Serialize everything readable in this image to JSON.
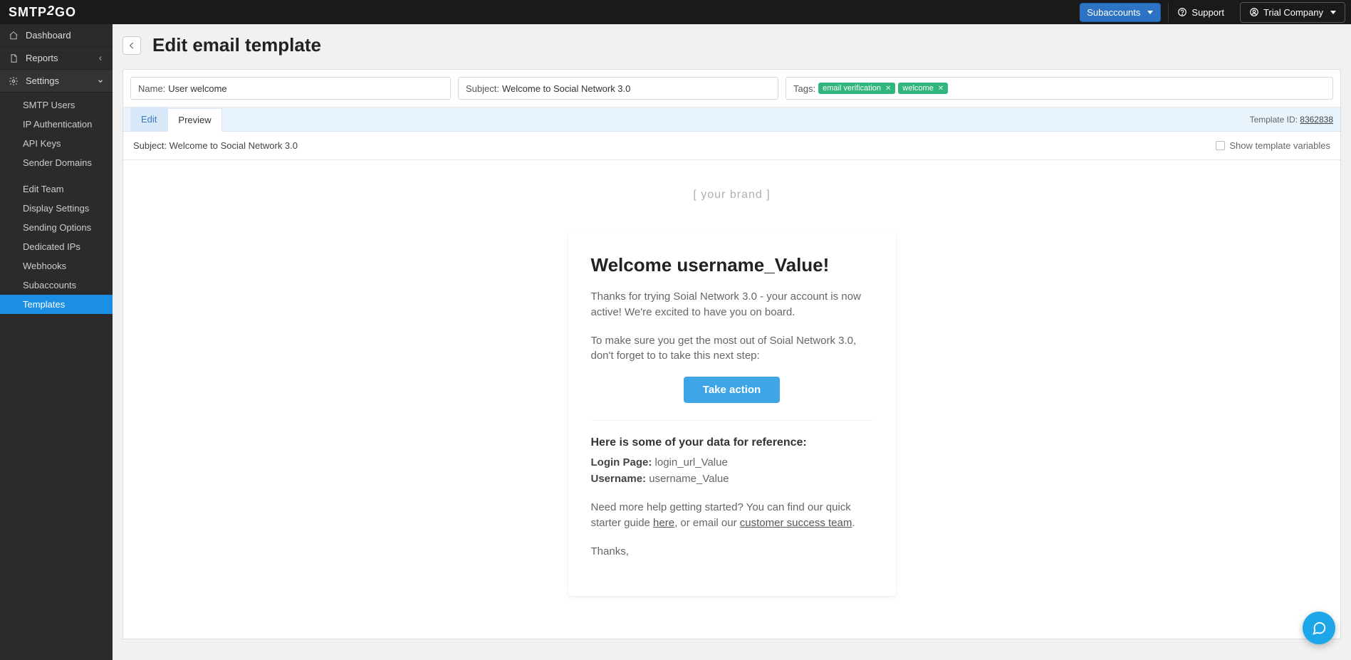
{
  "topbar": {
    "logo_pre": "SMTP",
    "logo_mid": "2",
    "logo_post": "GO",
    "subaccounts": "Subaccounts",
    "support": "Support",
    "company": "Trial Company"
  },
  "sidebar": {
    "dashboard": "Dashboard",
    "reports": "Reports",
    "settings": "Settings",
    "items_a": {
      "smtp_users": "SMTP Users",
      "ip_auth": "IP Authentication",
      "api_keys": "API Keys",
      "sender_domains": "Sender Domains"
    },
    "items_b": {
      "edit_team": "Edit Team",
      "display_settings": "Display Settings",
      "sending_options": "Sending Options",
      "dedicated_ips": "Dedicated IPs",
      "webhooks": "Webhooks",
      "subaccounts": "Subaccounts",
      "templates": "Templates"
    }
  },
  "page": {
    "title": "Edit email template",
    "name_label": "Name:",
    "name_value": "User welcome",
    "subject_label": "Subject:",
    "subject_value": "Welcome to Social Network 3.0",
    "tags_label": "Tags:",
    "tags": [
      "email verification",
      "welcome"
    ],
    "tab_edit": "Edit",
    "tab_preview": "Preview",
    "template_id_label": "Template ID:",
    "template_id_value": "8362838",
    "preview_subject_label": "Subject:",
    "preview_subject_value": "Welcome to Social Network 3.0",
    "show_vars": "Show template variables"
  },
  "email": {
    "brand_placeholder": "[   your brand   ]",
    "heading": "Welcome username_Value!",
    "p1": "Thanks for trying Soial Network 3.0 - your account is now active! We're excited to have you on board.",
    "p2": "To make sure you get the most out of Soial Network 3.0, don't forget to to take this next step:",
    "cta": "Take action",
    "ref_heading": "Here is some of your data for reference:",
    "login_label": "Login Page:",
    "login_value": "login_url_Value",
    "username_label": "Username:",
    "username_value": "username_Value",
    "help_pre": "Need more help getting started? You can find our quick starter guide ",
    "help_here": "here",
    "help_mid": ", or email our ",
    "help_team": "customer success team",
    "help_post": ".",
    "thanks": "Thanks,"
  }
}
